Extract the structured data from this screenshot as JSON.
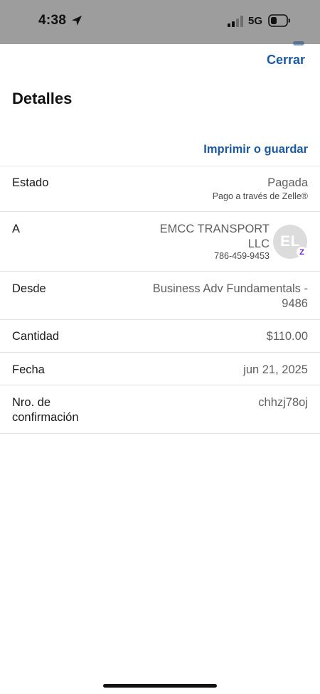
{
  "status_bar": {
    "time": "4:38",
    "network": "5G",
    "background_color": "#9d9d9d",
    "location_icon": "location-arrow-icon",
    "signal_icon": "cellular-signal-icon",
    "battery_icon": "battery-icon"
  },
  "header": {
    "close_label": "Cerrar",
    "title": "Detalles",
    "print_label": "Imprimir o guardar",
    "accent_color": "#1b5aa2"
  },
  "details": {
    "status": {
      "label": "Estado",
      "value": "Pagada",
      "sub": "Pago a través de Zelle®"
    },
    "recipient": {
      "label": "A",
      "name_line1": "EMCC TRANSPORT",
      "name_line2": "LLC",
      "phone": "786-459-9453",
      "avatar_initials": "EL",
      "badge_icon": "zelle-badge-icon",
      "badge_glyph": "Z",
      "badge_color": "#6d1ed4"
    },
    "from": {
      "label": "Desde",
      "value_line1": "Business Adv Fundamentals -",
      "value_line2": "9486"
    },
    "amount": {
      "label": "Cantidad",
      "value": "$110.00"
    },
    "date": {
      "label": "Fecha",
      "value": "jun 21, 2025"
    },
    "confirmation": {
      "label_line1": "Nro. de",
      "label_line2": "confirmación",
      "value": "chhzj78oj"
    }
  }
}
